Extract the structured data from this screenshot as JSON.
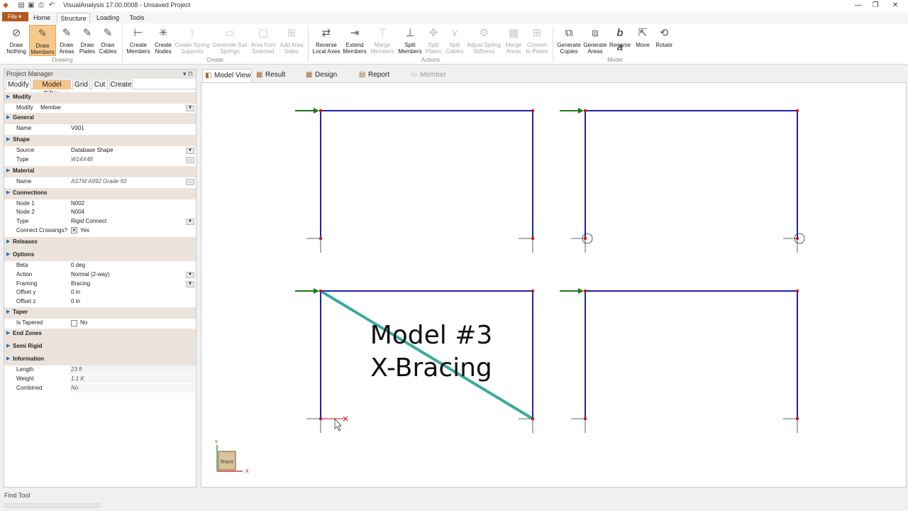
{
  "window": {
    "title": "VisualAnalysis 17.00.0008 - Unsaved Project",
    "minimize": "—",
    "restore": "❐",
    "close": "✕"
  },
  "ribbon_tabs": {
    "file": "File ▾",
    "tabs": [
      "Home",
      "Structure",
      "Loading",
      "Tools"
    ]
  },
  "ribbon": {
    "drawing": {
      "label": "Drawing",
      "buttons": [
        "Draw\nNothing",
        "Draw\nMembers",
        "Draw\nAreas",
        "Draw\nPlates",
        "Draw\nCables"
      ]
    },
    "create": {
      "label": "Create",
      "buttons": [
        "Create\nMembers",
        "Create\nNodes",
        "Create Spring\nSupports",
        "Generate Soil\nSprings",
        "Area from\nSelected",
        "Add Area\nSides"
      ]
    },
    "actions": {
      "label": "Actions",
      "buttons": [
        "Reverse\nLocal Axes",
        "Extend\nMembers",
        "Merge\nMembers",
        "Split\nMembers",
        "Split\nPlates",
        "Split\nCables",
        "Adjust Spring\nStiffness",
        "Merge\nAreas",
        "Convert\nto Plates"
      ]
    },
    "model": {
      "label": "Model",
      "buttons": [
        "Generate\nCopies",
        "Generate\nAreas",
        "Rename",
        "Move",
        "Rotate"
      ]
    }
  },
  "project_manager": {
    "title": "Project Manager",
    "pin": "▾ ⊓",
    "tabs": [
      "Modify",
      "Model Filter",
      "Grid",
      "Cut",
      "Create"
    ],
    "modify_section": "Modify",
    "modify_label": "Modify",
    "modify_value": "Member",
    "general": "General",
    "name_label": "Name",
    "name_value": "V001",
    "shape": "Shape",
    "source_label": "Source",
    "source_value": "Database Shape",
    "type_label": "Type",
    "type_value": "W14X48",
    "material": "Material",
    "mat_name_label": "Name",
    "mat_name_value": "ASTM A992 Grade 50",
    "connections": "Connections",
    "node1_label": "Node 1",
    "node1_value": "N002",
    "node2_label": "Node 2",
    "node2_value": "N004",
    "conn_type_label": "Type",
    "conn_type_value": "Rigid Connect",
    "crossings_label": "Connect Crossings?",
    "crossings_value": "Yes",
    "releases": "Releases",
    "options": "Options",
    "beta_label": "Beta",
    "beta_value": "0 deg",
    "action_label": "Action",
    "action_value": "Normal (2-way)",
    "framing_label": "Framing",
    "framing_value": "Bracing",
    "offy_label": "Offset y",
    "offy_value": "0 in",
    "offz_label": "Offset z",
    "offz_value": "0 in",
    "taper": "Taper",
    "tapered_label": "Is Tapered",
    "tapered_value": "No",
    "end_zones": "End Zones",
    "semi_rigid": "Semi Rigid",
    "information": "Information",
    "length_label": "Length",
    "length_value": "23 ft",
    "weight_label": "Weight",
    "weight_value": "1.1 K",
    "combined_label": "Combined",
    "combined_value": "No"
  },
  "view_tabs": [
    "Model View",
    "Result View",
    "Design View",
    "Report View",
    "Member Graph"
  ],
  "canvas": {
    "overlay_line1": "Model #3",
    "overlay_line2": "X-Bracing",
    "axis_x": "X",
    "axis_y": "Y",
    "cube_face": "Front",
    "member_color": "#2020b0",
    "brace_color": "#3aaaa0",
    "node_color": "#cc1111",
    "load_color": "#1a7a1a"
  },
  "status": {
    "find_tool": "Find Tool"
  }
}
